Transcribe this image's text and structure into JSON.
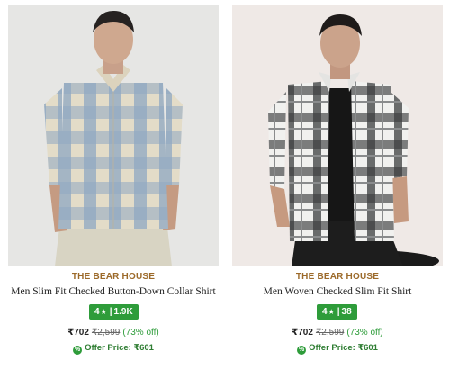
{
  "products": [
    {
      "brand": "THE BEAR HOUSE",
      "title": "Men Slim Fit Checked Button-Down Collar Shirt",
      "rating": "4",
      "reviews": "1.9K",
      "price": "₹702",
      "mrp": "₹2,599",
      "discount": "(73% off)",
      "offer_label": "Offer Price: ₹601",
      "image": "model-blue-beige-checked-shirt",
      "colors": {
        "bg": "#e6e6e4",
        "shirt_a": "#8fa8c2",
        "shirt_b": "#e3dcc8",
        "trousers": "#d8d4c3"
      }
    },
    {
      "brand": "THE BEAR HOUSE",
      "title": "Men Woven Checked Slim Fit Shirt",
      "rating": "4",
      "reviews": "38",
      "price": "₹702",
      "mrp": "₹2,599",
      "discount": "(73% off)",
      "offer_label": "Offer Price: ₹601",
      "image": "model-grey-white-checked-shirt",
      "colors": {
        "bg": "#efe9e6",
        "shirt_a": "#3c3e3f",
        "shirt_b": "#f1f1ef",
        "trousers": "#1d1d1d"
      }
    }
  ],
  "rating_star_icon": "star-icon",
  "offer_icon": "discount-tag-icon",
  "accent": {
    "brand": "#9c6a2a",
    "rating_bg": "#2e9c3a",
    "offer": "#2e7d32"
  }
}
